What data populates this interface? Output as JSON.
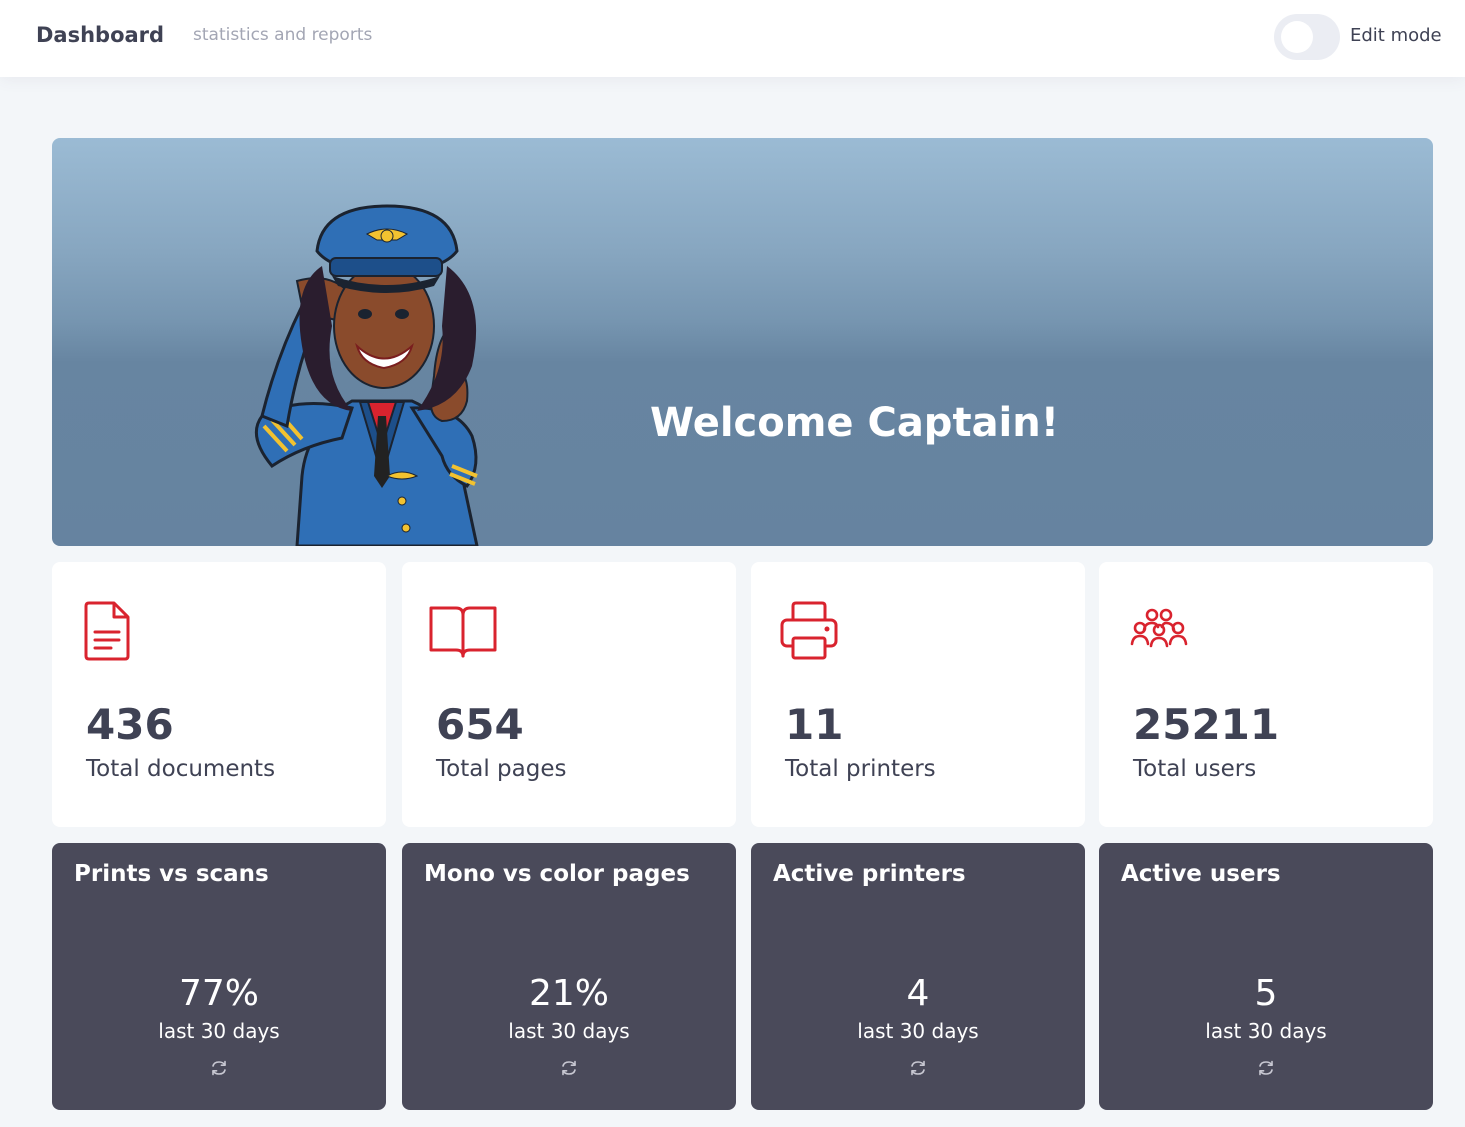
{
  "header": {
    "title": "Dashboard",
    "subtitle": "statistics and reports",
    "edit_mode_label": "Edit mode",
    "edit_mode_on": false
  },
  "hero": {
    "welcome": "Welcome Captain!",
    "illustration": "saluting-pilot-illustration"
  },
  "colors": {
    "accent": "#d9232e",
    "dark_card": "#4a4a5a",
    "text": "#3f4254",
    "muted": "#a3a6b4"
  },
  "stats": [
    {
      "icon": "document-icon",
      "value": "436",
      "label": "Total documents"
    },
    {
      "icon": "book-icon",
      "value": "654",
      "label": "Total pages"
    },
    {
      "icon": "printer-icon",
      "value": "11",
      "label": "Total printers"
    },
    {
      "icon": "users-group-icon",
      "value": "25211",
      "label": "Total users"
    }
  ],
  "kpis": [
    {
      "title": "Prints vs scans",
      "value": "77%",
      "period": "last 30 days",
      "icon": "refresh-icon"
    },
    {
      "title": "Mono vs color pages",
      "value": "21%",
      "period": "last 30 days",
      "icon": "refresh-icon"
    },
    {
      "title": "Active printers",
      "value": "4",
      "period": "last 30 days",
      "icon": "refresh-icon"
    },
    {
      "title": "Active users",
      "value": "5",
      "period": "last 30 days",
      "icon": "refresh-icon"
    }
  ]
}
